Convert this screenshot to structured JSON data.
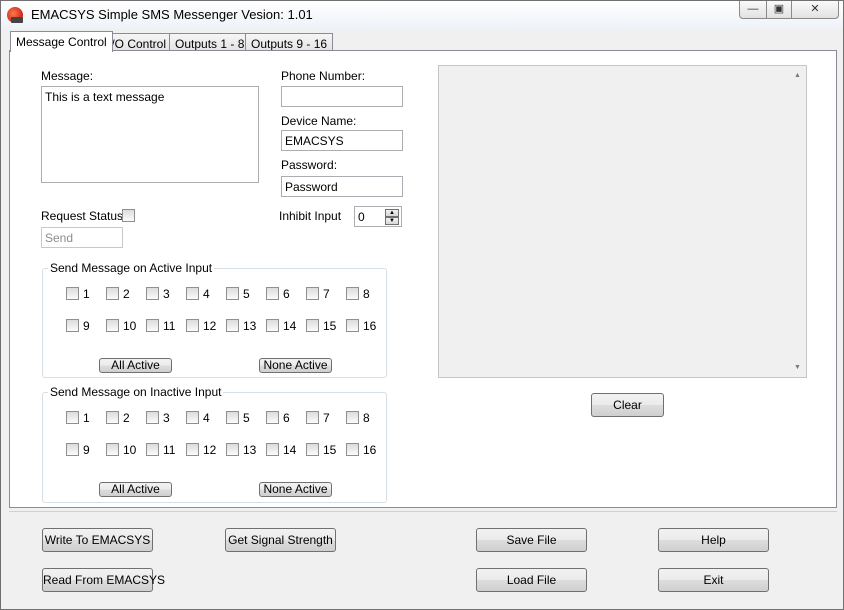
{
  "window": {
    "title": "EMACSYS Simple SMS Messenger Vesion: 1.01",
    "min_glyph": "—",
    "max_glyph": "▣",
    "close_glyph": "✕"
  },
  "tabs": [
    {
      "label": "Message Control",
      "active": true
    },
    {
      "label": "I/O Control",
      "active": false
    },
    {
      "label": "Outputs 1 - 8",
      "active": false
    },
    {
      "label": "Outputs 9 - 16",
      "active": false
    }
  ],
  "message": {
    "label": "Message:",
    "value": "This is a text message"
  },
  "phone": {
    "label": "Phone Number:",
    "value": ""
  },
  "device": {
    "label": "Device Name:",
    "value": "EMACSYS"
  },
  "password": {
    "label": "Password:",
    "value": "Password"
  },
  "request_status": {
    "label": "Request Status",
    "checked": false
  },
  "send": {
    "placeholder": "Send"
  },
  "inhibit": {
    "label": "Inhibit Input",
    "value": "0",
    "up_glyph": "▲",
    "down_glyph": "▼"
  },
  "active_group": {
    "title": "Send Message on Active Input",
    "inputs": [
      "1",
      "2",
      "3",
      "4",
      "5",
      "6",
      "7",
      "8",
      "9",
      "10",
      "11",
      "12",
      "13",
      "14",
      "15",
      "16"
    ],
    "all_label": "All Active",
    "none_label": "None Active"
  },
  "inactive_group": {
    "title": "Send Message on Inactive Input",
    "inputs": [
      "1",
      "2",
      "3",
      "4",
      "5",
      "6",
      "7",
      "8",
      "9",
      "10",
      "11",
      "12",
      "13",
      "14",
      "15",
      "16"
    ],
    "all_label": "All Active",
    "none_label": "None Active"
  },
  "log": {
    "up_glyph": "▲",
    "down_glyph": "▼"
  },
  "clear_label": "Clear",
  "bottom_buttons": {
    "write": "Write To EMACSYS",
    "read": "Read From EMACSYS",
    "signal": "Get Signal Strength",
    "save": "Save File",
    "load": "Load File",
    "help": "Help",
    "exit": "Exit"
  }
}
